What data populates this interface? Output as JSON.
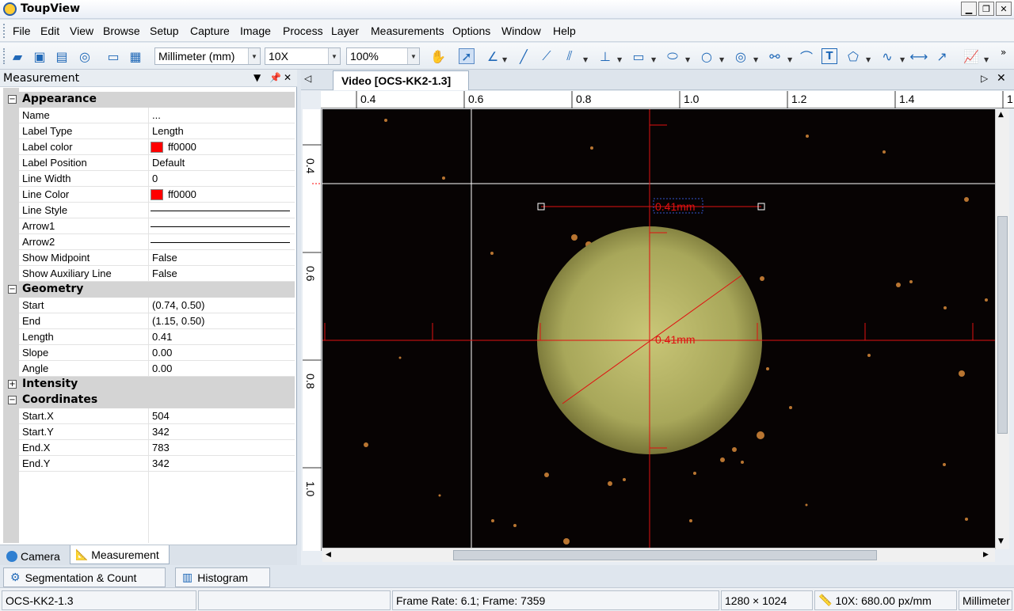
{
  "window": {
    "title": "ToupView"
  },
  "menu": [
    "File",
    "Edit",
    "View",
    "Browse",
    "Setup",
    "Capture",
    "Image",
    "Process",
    "Layer",
    "Measurements",
    "Options",
    "Window",
    "Help"
  ],
  "toolbar": {
    "unit": "Millimeter (mm)",
    "magnification": "10X",
    "zoom": "100%"
  },
  "icons": [
    "open-icon",
    "save-icon",
    "save-as-icon",
    "camera-icon",
    "browse-icon",
    "grid-icon",
    "hand-icon",
    "pointer-icon",
    "angle-icon",
    "line-icon",
    "polyline-icon",
    "parallel-icon",
    "perpendicular-icon",
    "rectangle-icon",
    "ellipse-icon",
    "circle-icon",
    "concentric-circle-icon",
    "link-icon",
    "arc-icon",
    "text-icon",
    "polygon-icon",
    "curve-icon",
    "scale-bar-icon",
    "arrow-icon",
    "calibrate-icon"
  ],
  "panel": {
    "title": "Measurement",
    "categories": {
      "appearance": "Appearance",
      "geometry": "Geometry",
      "intensity": "Intensity",
      "coordinates": "Coordinates"
    },
    "appearance": [
      {
        "name": "Name",
        "value": "..."
      },
      {
        "name": "Label Type",
        "value": "Length"
      },
      {
        "name": "Label color",
        "value": "ff0000"
      },
      {
        "name": "Label Position",
        "value": "Default"
      },
      {
        "name": "Line Width",
        "value": "0"
      },
      {
        "name": "Line Color",
        "value": "ff0000"
      },
      {
        "name": "Line Style",
        "value": ""
      },
      {
        "name": "Arrow1",
        "value": ""
      },
      {
        "name": "Arrow2",
        "value": ""
      },
      {
        "name": "Show Midpoint",
        "value": "False"
      },
      {
        "name": "Show Auxiliary Line",
        "value": "False"
      }
    ],
    "geometry": [
      {
        "name": "Start",
        "value": "(0.74, 0.50)"
      },
      {
        "name": "End",
        "value": "(1.15, 0.50)"
      },
      {
        "name": "Length",
        "value": "0.41"
      },
      {
        "name": "Slope",
        "value": "0.00"
      },
      {
        "name": "Angle",
        "value": "0.00"
      }
    ],
    "coordinates": [
      {
        "name": "Start.X",
        "value": "504"
      },
      {
        "name": "Start.Y",
        "value": "342"
      },
      {
        "name": "End.X",
        "value": "783"
      },
      {
        "name": "End.Y",
        "value": "342"
      }
    ],
    "tabs": [
      "Camera",
      "Measurement"
    ]
  },
  "document": {
    "tab": "Video [OCS-KK2-1.3]",
    "ruler_top": [
      "0.4",
      "0.6",
      "0.8",
      "1.0",
      "1.2",
      "1.4",
      "1"
    ],
    "ruler_left": [
      "0.4",
      "0.6",
      "0.8",
      "1.0"
    ],
    "measure_label_1": "0.41mm",
    "measure_label_2": "0.41mm"
  },
  "bottom_tabs": [
    "Segmentation & Count",
    "Histogram"
  ],
  "status": {
    "name": "OCS-KK2-1.3",
    "frame": "Frame Rate: 6.1; Frame: 7359",
    "resolution": "1280 × 1024",
    "calibration": "10X: 680.00 px/mm",
    "unit": "Millimeter"
  },
  "colors": {
    "accent": "#1f68b7",
    "measure": "#ff0000",
    "label_color": "#ff0000",
    "line_color": "#ff0000"
  }
}
